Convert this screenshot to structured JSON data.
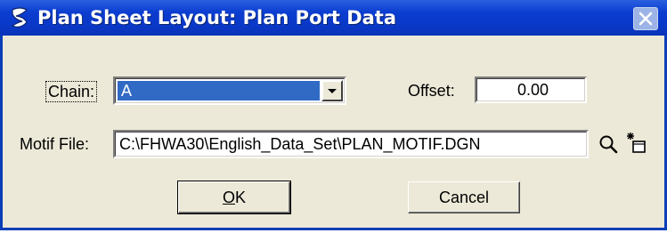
{
  "window": {
    "title": "Plan Sheet Layout: Plan Port Data",
    "close_icon": "close-icon"
  },
  "form": {
    "chain": {
      "label": "Chain:",
      "value": "A"
    },
    "offset": {
      "label": "Offset:",
      "value": "0.00"
    },
    "motif_file": {
      "label": "Motif File:",
      "value": "C:\\FHWA30\\English_Data_Set\\PLAN_MOTIF.DGN"
    }
  },
  "icons": {
    "browse": "magnifier-icon",
    "new_file": "new-file-icon"
  },
  "buttons": {
    "ok": {
      "label_mnemonic": "O",
      "label_rest": "K"
    },
    "cancel": "Cancel"
  },
  "colors": {
    "titlebar": "#0b3dd0",
    "selection": "#316ac5",
    "dialog_bg": "#ece9d8"
  }
}
